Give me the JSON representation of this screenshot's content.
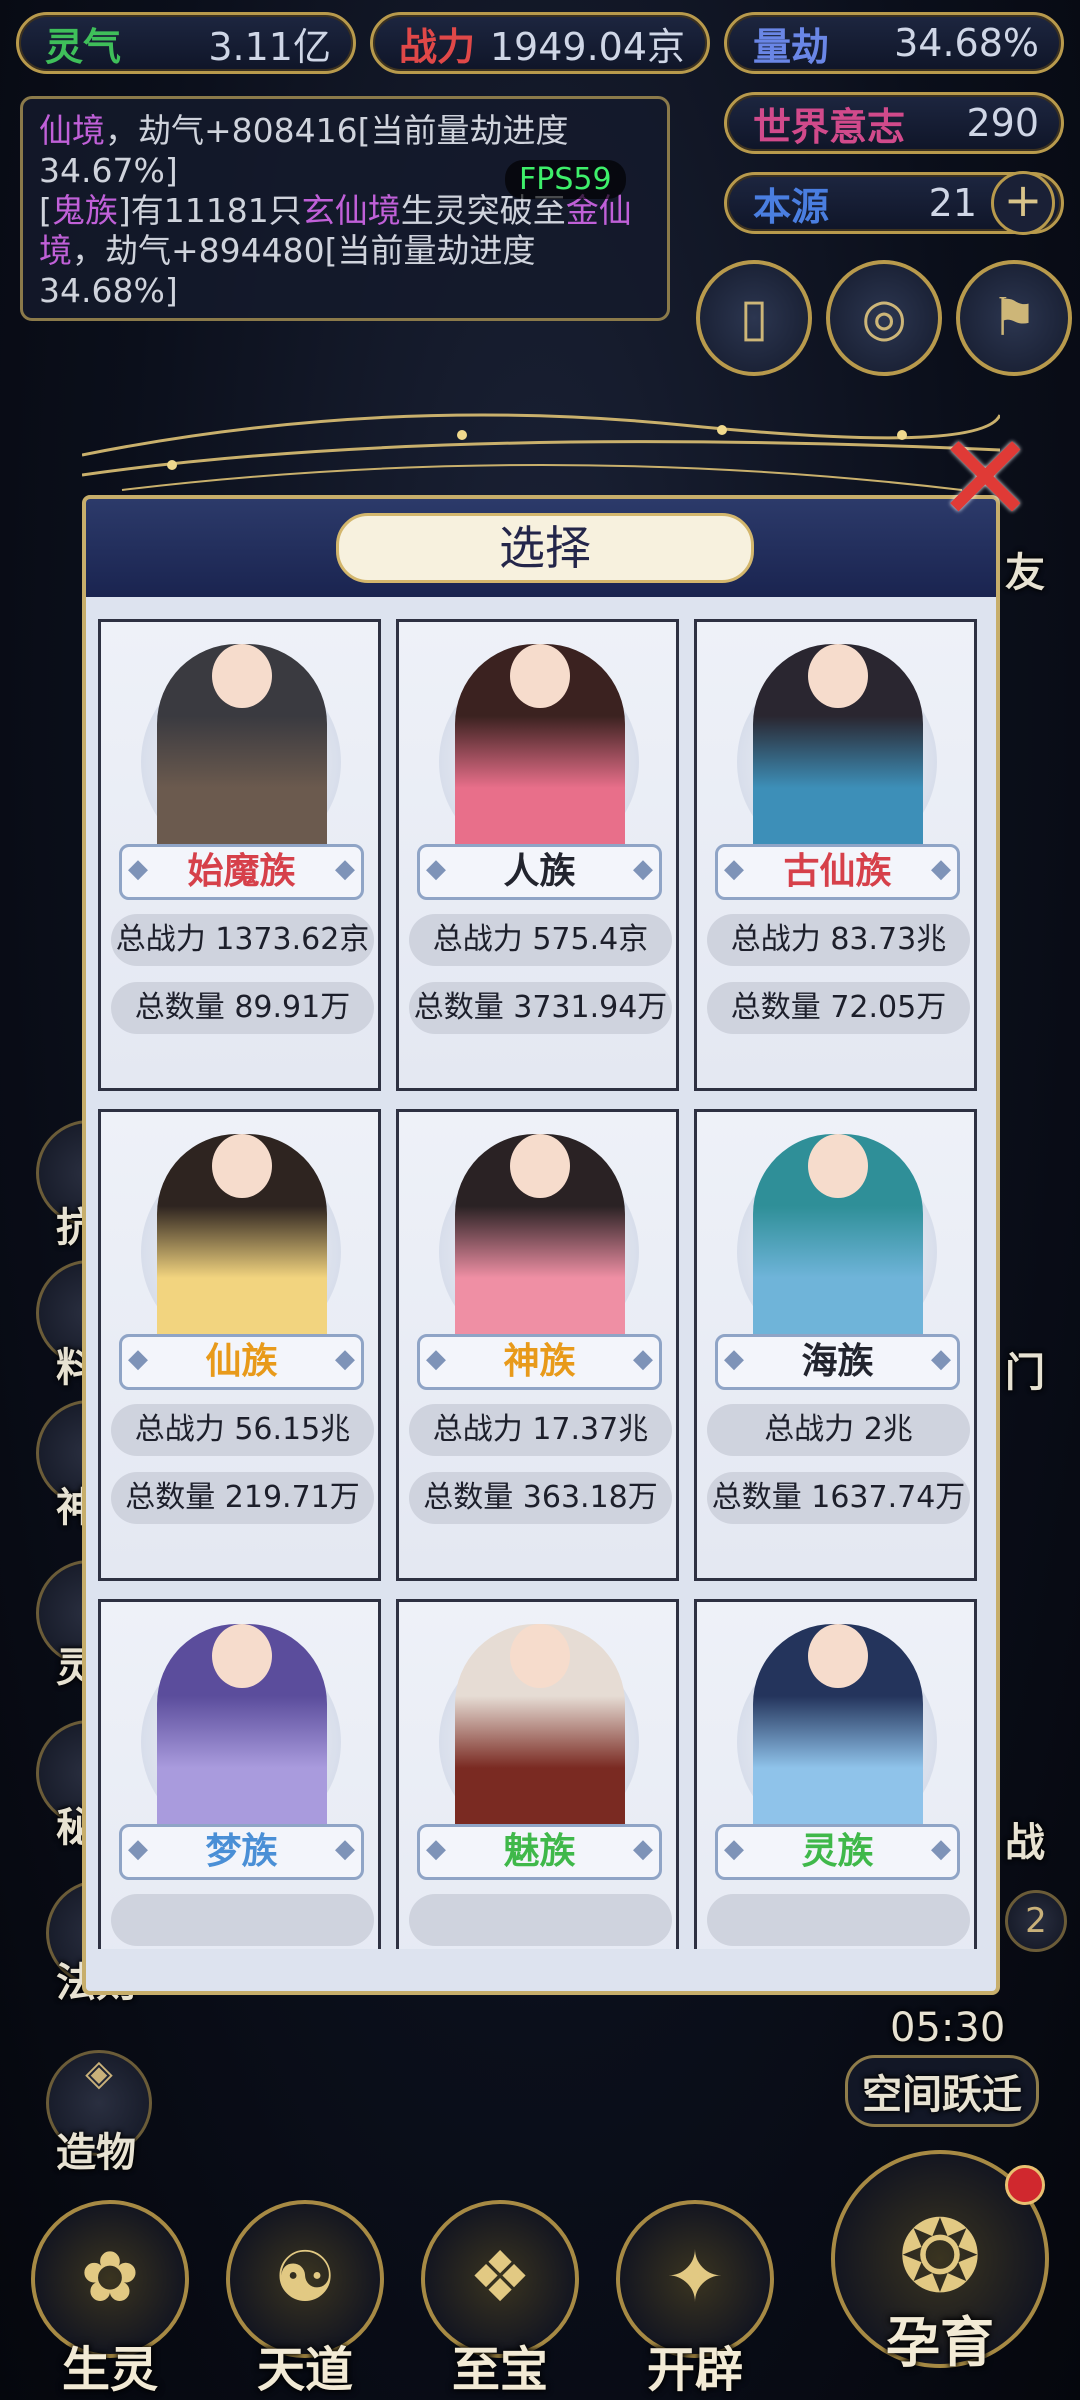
{
  "header": {
    "resources": [
      {
        "label": "灵气",
        "value": "3.11亿",
        "color": "#3fbf5a"
      },
      {
        "label": "战力",
        "value": "1949.04京",
        "color": "#e04848"
      },
      {
        "label": "量劫",
        "value": "34.68%",
        "color": "#6a86e6"
      },
      {
        "label": "世界意志",
        "value": "290",
        "color": "#d14a8b"
      },
      {
        "label": "本源",
        "value": "21",
        "color": "#4a7ee0"
      }
    ],
    "plus_label": "+",
    "fps": "FPS59"
  },
  "log": {
    "line1_a": "仙境",
    "line1_b": "，劫气+808416[当前量劫进度",
    "line2": "34.67%]",
    "line3_a": "[",
    "line3_race": "鬼族",
    "line3_b": "]有11181只",
    "line3_realm": "玄仙境",
    "line3_c": "生灵突破至",
    "line3_realm2": "金仙",
    "line4_a": "境",
    "line4_b": "，劫气+894480[当前量劫进度",
    "line5": "34.68%]"
  },
  "side_left": {
    "fa_ze": "法则",
    "zao_wu": "造物",
    "partial": [
      "抗",
      "料",
      "神",
      "灵",
      "秘"
    ]
  },
  "side_right": {
    "timer": "05:30",
    "space_jump": "空间跃迁",
    "partial": [
      "友",
      "门",
      "战"
    ],
    "badge": "2"
  },
  "bottom_nav": [
    {
      "label": "生灵",
      "icon": "✿"
    },
    {
      "label": "天道",
      "icon": "☯"
    },
    {
      "label": "至宝",
      "icon": "❖"
    },
    {
      "label": "开辟",
      "icon": "✦"
    },
    {
      "label": "孕育",
      "icon": "❂"
    }
  ],
  "modal": {
    "title": "选择",
    "close_label": "✕",
    "cards": [
      {
        "name": "始魔族",
        "name_color": "#d6404a",
        "power": "总战力 1373.62京",
        "count": "总数量 89.91万",
        "robe": "#6b5a4e",
        "hair": "#3a3a40"
      },
      {
        "name": "人族",
        "name_color": "#22242e",
        "power": "总战力 575.4京",
        "count": "总数量 3731.94万",
        "robe": "#e86f8a",
        "hair": "#3b2220"
      },
      {
        "name": "古仙族",
        "name_color": "#d6404a",
        "power": "总战力 83.73兆",
        "count": "总数量 72.05万",
        "robe": "#3d8fb8",
        "hair": "#2a2630"
      },
      {
        "name": "仙族",
        "name_color": "#e89a1a",
        "power": "总战力 56.15兆",
        "count": "总数量 219.71万",
        "robe": "#f2d47f",
        "hair": "#2e2420"
      },
      {
        "name": "神族",
        "name_color": "#e89a1a",
        "power": "总战力 17.37兆",
        "count": "总数量 363.18万",
        "robe": "#ef8fa4",
        "hair": "#2a2224"
      },
      {
        "name": "海族",
        "name_color": "#22242e",
        "power": "总战力 2兆",
        "count": "总数量 1637.74万",
        "robe": "#6fb4d9",
        "hair": "#2f8f98"
      },
      {
        "name": "梦族",
        "name_color": "#4a8fd6",
        "power": "",
        "count": "",
        "robe": "#a99bdd",
        "hair": "#5b4d9c"
      },
      {
        "name": "魅族",
        "name_color": "#3fb84a",
        "power": "",
        "count": "",
        "robe": "#7a2a22",
        "hair": "#e6dcd4"
      },
      {
        "name": "灵族",
        "name_color": "#3fb84a",
        "power": "",
        "count": "",
        "robe": "#8fc3ea",
        "hair": "#24345c"
      }
    ]
  }
}
